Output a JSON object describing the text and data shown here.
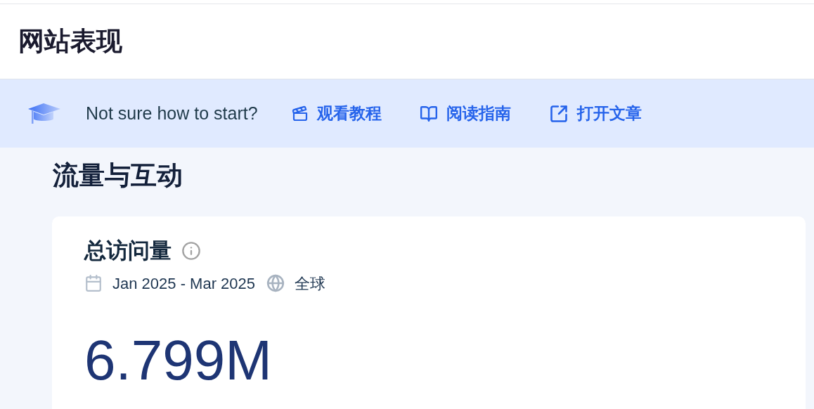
{
  "page_title": "网站表现",
  "banner": {
    "prompt": "Not sure how to start?",
    "links": [
      {
        "kind": "video",
        "label": "观看教程"
      },
      {
        "kind": "book",
        "label": "阅读指南"
      },
      {
        "kind": "external",
        "label": "打开文章"
      }
    ]
  },
  "section_title": "流量与互动",
  "card": {
    "title": "总访问量",
    "date_range": "Jan 2025 - Mar 2025",
    "region": "全球",
    "value": "6.799M"
  }
}
